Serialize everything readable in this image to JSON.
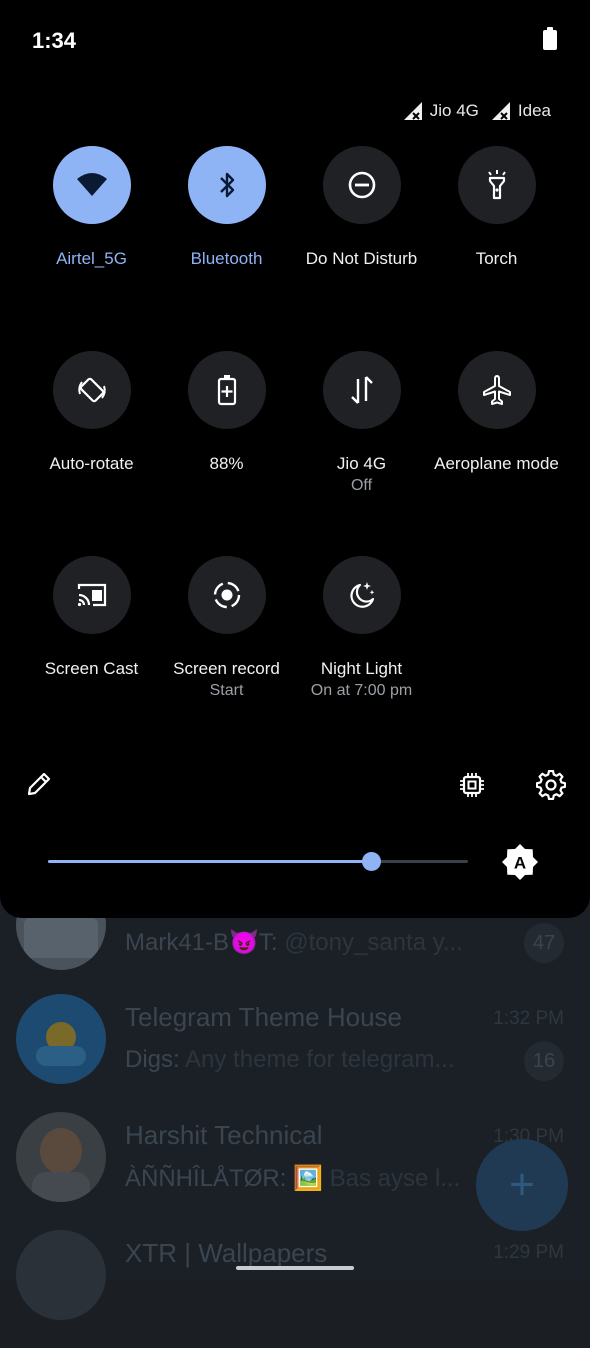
{
  "status_bar": {
    "time": "1:34"
  },
  "carriers": [
    {
      "name": "Jio 4G"
    },
    {
      "name": "Idea"
    }
  ],
  "tiles": [
    {
      "label": "Airtel_5G",
      "icon": "wifi-icon",
      "active": true
    },
    {
      "label": "Bluetooth",
      "icon": "bluetooth-icon",
      "active": true
    },
    {
      "label": "Do Not Disturb",
      "icon": "do-not-disturb-icon",
      "active": false
    },
    {
      "label": "Torch",
      "icon": "torch-icon",
      "active": false
    },
    {
      "label": "Auto-rotate",
      "icon": "auto-rotate-icon",
      "active": false
    },
    {
      "label": "88%",
      "icon": "battery-saver-icon",
      "active": false
    },
    {
      "label": "Jio 4G",
      "sub": "Off",
      "icon": "mobile-data-icon",
      "active": false
    },
    {
      "label": "Aeroplane mode",
      "icon": "airplane-icon",
      "active": false
    },
    {
      "label": "Screen Cast",
      "icon": "cast-icon",
      "active": false
    },
    {
      "label": "Screen record",
      "sub": "Start",
      "icon": "screen-record-icon",
      "active": false
    },
    {
      "label": "Night Light",
      "sub": "On at 7:00 pm",
      "icon": "night-light-icon",
      "active": false
    }
  ],
  "brightness": {
    "level_percent": 77,
    "auto_icon_letter": "A"
  },
  "colors": {
    "accent": "#8eb4f5",
    "panel": "#000000",
    "tile_off": "#1f2125"
  },
  "chats": [
    {
      "title": "",
      "time": "",
      "sender": "Mark41-B😈T:",
      "preview": "@tony_santa y...",
      "badge": "47"
    },
    {
      "title": "Telegram Theme House",
      "time": "1:32 PM",
      "sender": "Digs:",
      "preview": "Any theme for telegram...",
      "badge": "16"
    },
    {
      "title": "Harshit Technical",
      "time": "1:30 PM",
      "sender": "ÀÑÑHÎLÅTØR:",
      "preview": "🖼️ Bas ayse l...",
      "badge": ""
    },
    {
      "title": "XTR | Wallpapers",
      "time": "1:29 PM",
      "sender": "",
      "preview": "",
      "badge": ""
    }
  ],
  "fab_label": "+"
}
